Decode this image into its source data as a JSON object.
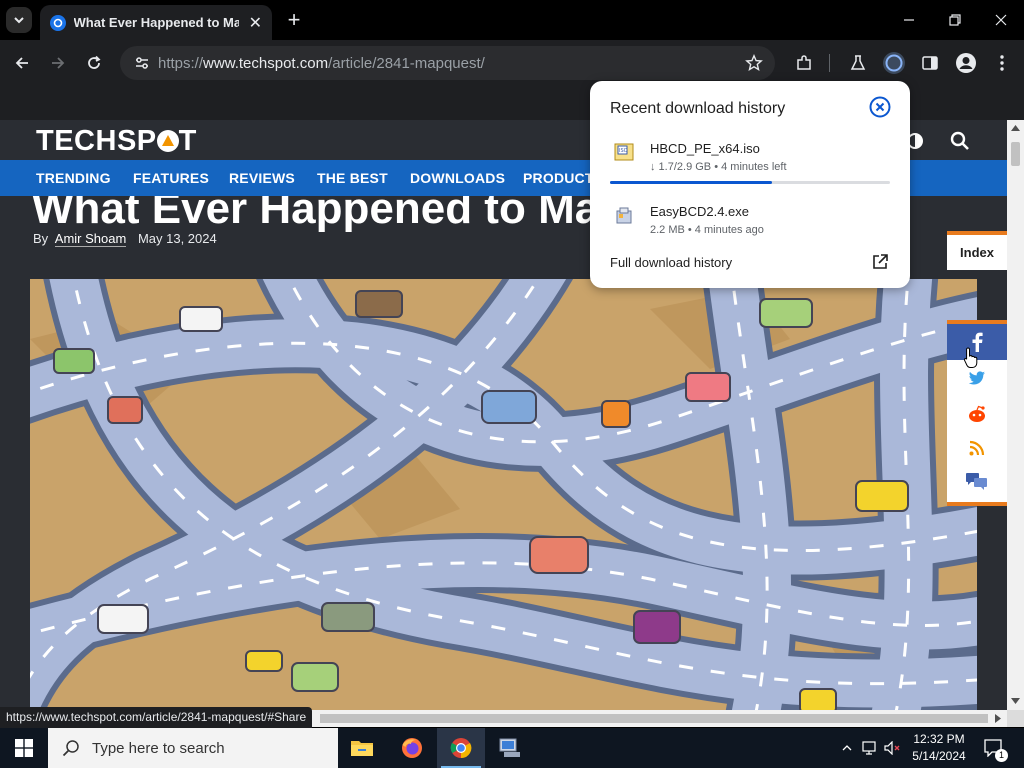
{
  "browser": {
    "tab": {
      "title": "What Ever Happened to MapQ",
      "favicon": "chrome-favicon-icon"
    },
    "window_controls": [
      "minimize-icon",
      "restore-icon",
      "close-icon"
    ],
    "omnibox": {
      "scheme": "https://",
      "host": "www.techspot.com",
      "path": "/article/2841-mapquest/"
    },
    "status_url": "https://www.techspot.com/article/2841-mapquest/#Share"
  },
  "site": {
    "logo": "TECHSPOT",
    "nav": [
      "TRENDING",
      "FEATURES",
      "REVIEWS",
      "THE BEST",
      "DOWNLOADS",
      "PRODUCT"
    ],
    "colors": {
      "header_bg": "#2a2d33",
      "nav_bg": "#1565c0",
      "accent": "#e87b1e"
    }
  },
  "article": {
    "title": "What Ever Happened to MapQuest?",
    "by_prefix": "By",
    "author": "Amir Shoam",
    "date": "May 13, 2024"
  },
  "sidebar": {
    "index_label": "Index",
    "share_icons": [
      "facebook-icon",
      "twitter-icon",
      "reddit-icon",
      "rss-icon",
      "comments-icon"
    ]
  },
  "downloads": {
    "title": "Recent download history",
    "items": [
      {
        "name": "HBCD_PE_x64.iso",
        "meta": "↓ 1.7/2.9 GB • 4 minutes left",
        "progress": 0.58
      },
      {
        "name": "EasyBCD2.4.exe",
        "meta": "2.2 MB • 4 minutes ago"
      }
    ],
    "full_history_label": "Full download history"
  },
  "taskbar": {
    "search_placeholder": "Type here to search",
    "apps": [
      "file-explorer-icon",
      "firefox-icon",
      "chrome-icon",
      "network-app-icon"
    ],
    "clock": {
      "time": "12:32 PM",
      "date": "5/14/2024"
    },
    "notification_count": "1"
  }
}
